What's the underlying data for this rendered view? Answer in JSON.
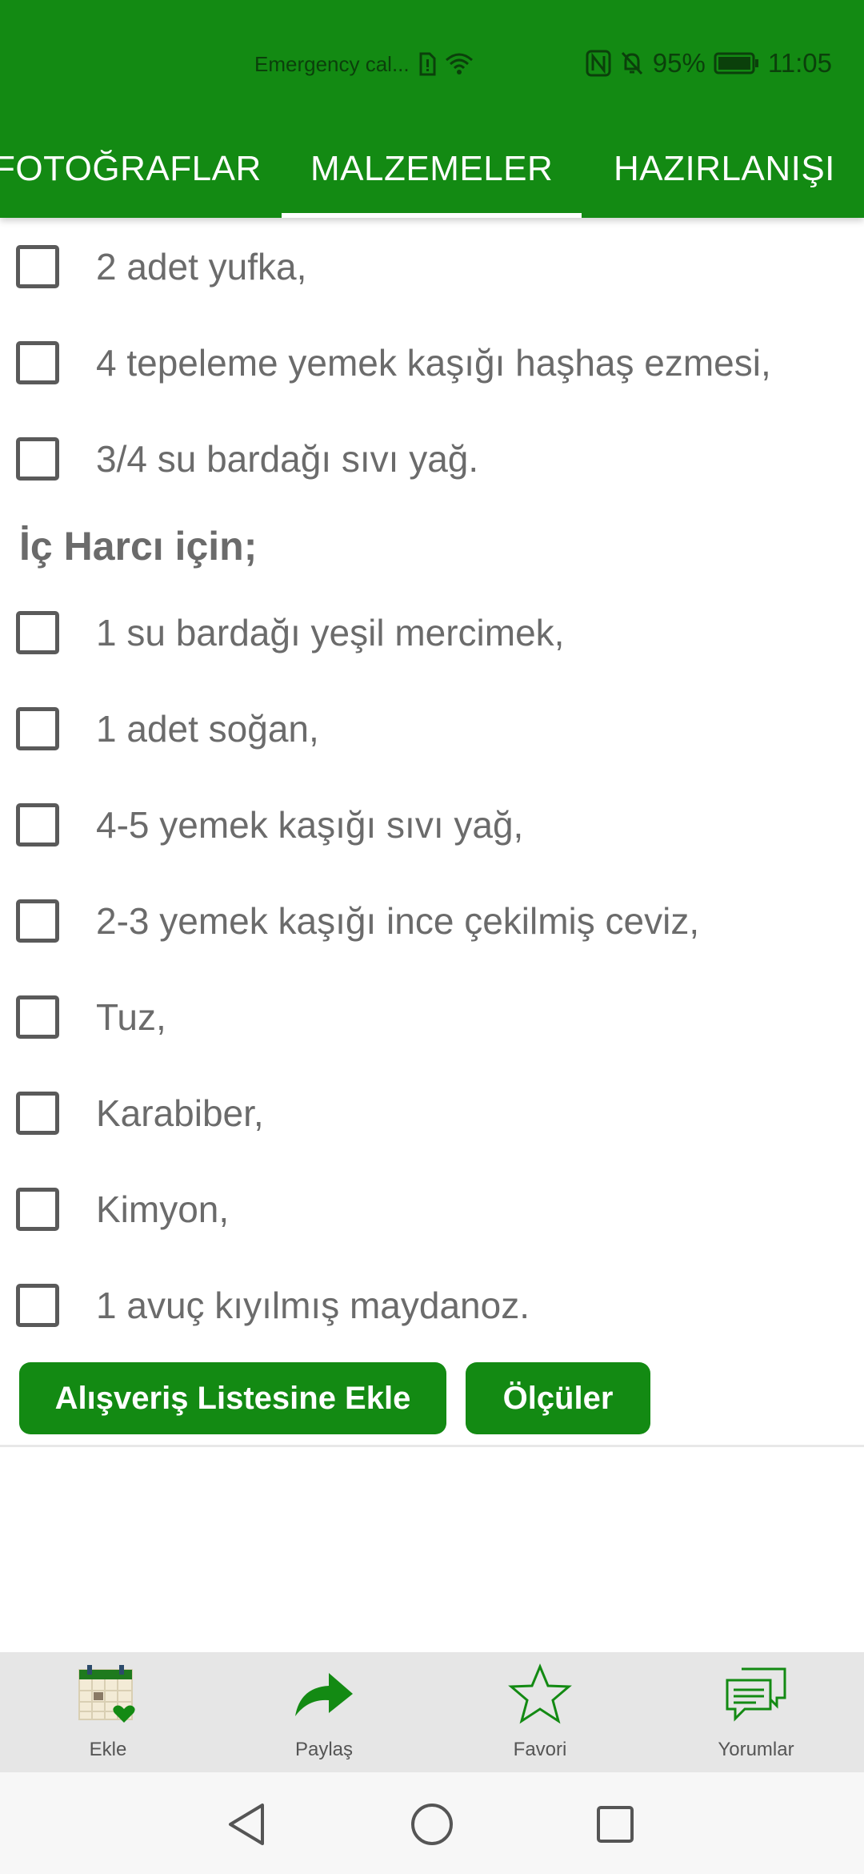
{
  "status_bar": {
    "carrier": "Emergency cal...",
    "battery": "95%",
    "time": "11:05"
  },
  "tabs": [
    {
      "label": "FOTOĞRAFLAR",
      "active": false
    },
    {
      "label": "MALZEMELER",
      "active": true
    },
    {
      "label": "HAZIRLANIŞI",
      "active": false
    }
  ],
  "ingredients": {
    "top_items": [
      "2 adet yufka,",
      "4 tepeleme yemek kaşığı haşhaş ezmesi,",
      "3/4 su bardağı sıvı yağ."
    ],
    "section_title": "İç Harcı için;",
    "filling_items": [
      "1 su bardağı yeşil mercimek,",
      "1 adet soğan,",
      "4-5 yemek kaşığı sıvı yağ,",
      "2-3 yemek kaşığı ince çekilmiş ceviz,",
      "Tuz,",
      "Karabiber,",
      "Kimyon,",
      "1 avuç kıyılmış maydanoz."
    ]
  },
  "buttons": {
    "shopping_list": "Alışveriş Listesine Ekle",
    "measures": "Ölçüler"
  },
  "bottom_bar": [
    {
      "label": "Ekle",
      "icon": "calendar-heart-icon"
    },
    {
      "label": "Paylaş",
      "icon": "share-arrow-icon"
    },
    {
      "label": "Favori",
      "icon": "star-icon"
    },
    {
      "label": "Yorumlar",
      "icon": "comments-icon"
    }
  ],
  "colors": {
    "primary": "#138a13",
    "text_gray": "#6b6b6b",
    "checkbox_border": "#5a5a5a"
  }
}
